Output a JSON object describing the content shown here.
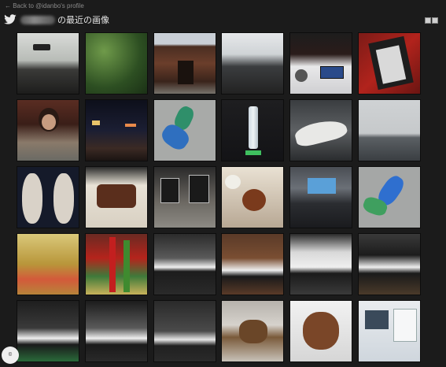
{
  "header": {
    "back_link": "← Back to @idanbo's profile",
    "title": "の最近の画像"
  },
  "icons": {
    "twitter": "twitter-bird-icon",
    "grid_view": "grid-view-icon",
    "list_view": "list-view-icon"
  },
  "accent_color": "#2aa9e0",
  "corner_badge_text": "©"
}
